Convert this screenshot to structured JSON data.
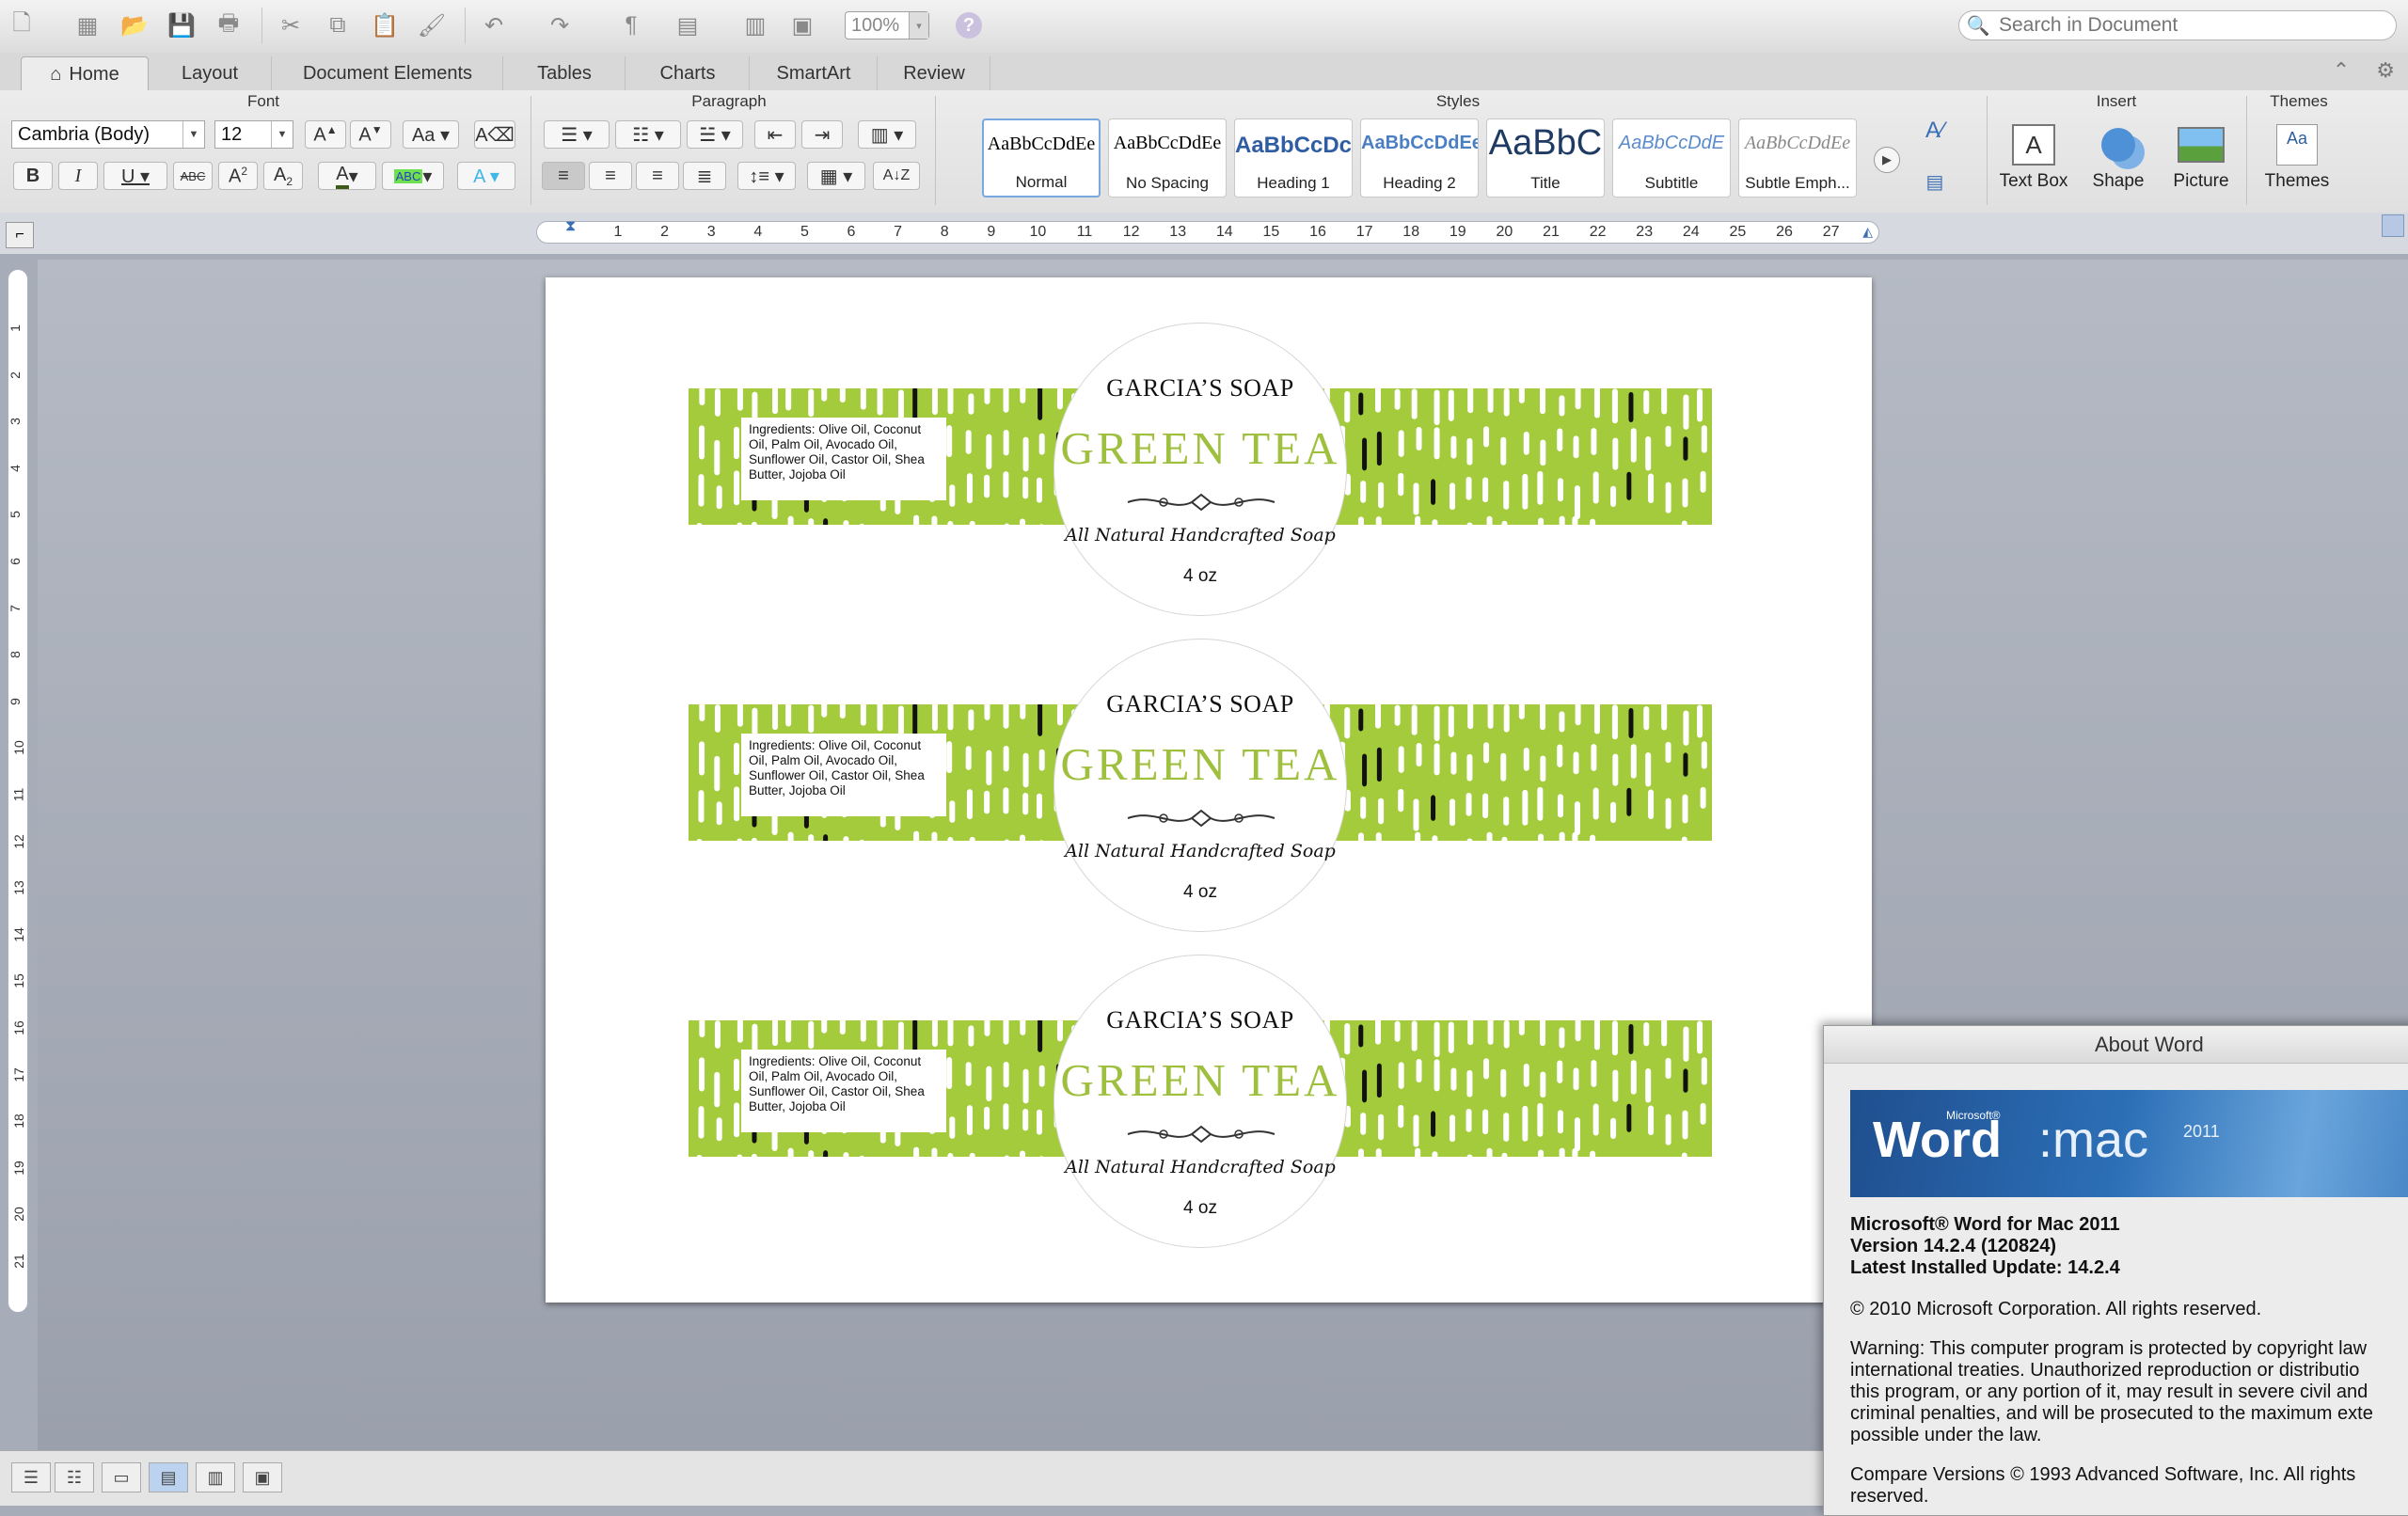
{
  "toolbar": {
    "zoom": "100%",
    "search_placeholder": "Search in Document"
  },
  "tabs": [
    "Home",
    "Layout",
    "Document Elements",
    "Tables",
    "Charts",
    "SmartArt",
    "Review"
  ],
  "ribbon": {
    "groups": {
      "font": "Font",
      "paragraph": "Paragraph",
      "styles": "Styles",
      "insert": "Insert",
      "themes": "Themes"
    },
    "font_name": "Cambria (Body)",
    "font_size": "12",
    "styles": [
      {
        "sample": "AaBbCcDdEe",
        "name": "Normal"
      },
      {
        "sample": "AaBbCcDdEe",
        "name": "No Spacing"
      },
      {
        "sample": "AaBbCcDc",
        "name": "Heading 1"
      },
      {
        "sample": "AaBbCcDdEe",
        "name": "Heading 2"
      },
      {
        "sample": "AaBbC",
        "name": "Title"
      },
      {
        "sample": "AaBbCcDdE",
        "name": "Subtitle"
      },
      {
        "sample": "AaBbCcDdEe",
        "name": "Subtle Emph..."
      }
    ],
    "insert": {
      "text_box": "Text Box",
      "shape": "Shape",
      "picture": "Picture"
    },
    "themes_label": "Themes"
  },
  "ruler_numbers": [
    "1",
    "2",
    "3",
    "4",
    "5",
    "6",
    "7",
    "8",
    "9",
    "10",
    "11",
    "12",
    "13",
    "14",
    "15",
    "16",
    "17",
    "18",
    "19",
    "20",
    "21",
    "22",
    "23",
    "24",
    "25",
    "26",
    "27"
  ],
  "vruler_numbers": [
    "1",
    "2",
    "3",
    "4",
    "5",
    "6",
    "7",
    "8",
    "9",
    "10",
    "11",
    "12",
    "13",
    "14",
    "15",
    "16",
    "17",
    "18",
    "19",
    "20",
    "21"
  ],
  "labels": [
    {
      "brand": "GARCIA’S SOAP",
      "flavor": "GREEN TEA",
      "tagline": "All Natural Handcrafted Soap",
      "weight": "4 oz",
      "ingredients": "Ingredients: Olive Oil, Coconut Oil, Palm Oil, Avocado Oil, Sunflower Oil, Castor Oil, Shea Butter, Jojoba Oil"
    },
    {
      "brand": "GARCIA’S SOAP",
      "flavor": "GREEN TEA",
      "tagline": "All Natural Handcrafted Soap",
      "weight": "4 oz",
      "ingredients": "Ingredients: Olive Oil, Coconut Oil, Palm Oil, Avocado Oil, Sunflower Oil, Castor Oil, Shea Butter, Jojoba Oil"
    },
    {
      "brand": "GARCIA’S SOAP",
      "flavor": "GREEN TEA",
      "tagline": "All Natural Handcrafted Soap",
      "weight": "4 oz",
      "ingredients": "Ingredients: Olive Oil, Coconut Oil, Palm Oil, Avocado Oil, Sunflower Oil, Castor Oil, Shea Butter, Jojoba Oil"
    }
  ],
  "about": {
    "title": "About Word",
    "splash_ms": "Microsoft®",
    "splash_word": "Word",
    "splash_mac": ":mac",
    "splash_year": "2011",
    "product": "Microsoft® Word for Mac 2011",
    "version": "Version 14.2.4 (120824)",
    "update": "Latest Installed Update: 14.2.4",
    "copyright": "© 2010 Microsoft Corporation. All rights reserved.",
    "warning_lines": [
      "Warning: This computer program is protected by copyright law",
      "international treaties.  Unauthorized reproduction or distributio",
      "this program, or any portion of it, may result in severe civil and",
      "criminal penalties, and will be prosecuted to the maximum exte",
      "possible under the law."
    ],
    "compare_lines": [
      "Compare Versions © 1993 Advanced Software, Inc.  All rights",
      "reserved."
    ]
  },
  "colors": {
    "label_green": "#a3cb3c",
    "flavor_green": "#9fbf3e"
  }
}
